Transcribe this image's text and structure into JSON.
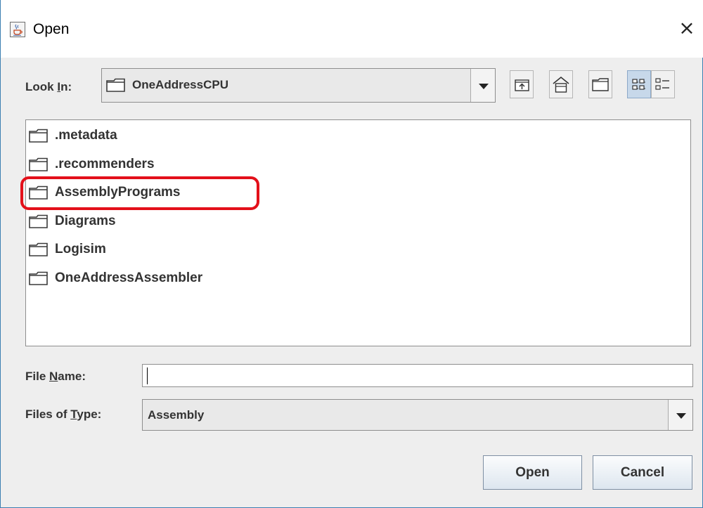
{
  "window": {
    "title": "Open",
    "close_glyph": "×",
    "icon": "java-cup-icon"
  },
  "look_in": {
    "label": "Look In:",
    "mnemonic": "L",
    "selected": "OneAddressCPU"
  },
  "toolbar": {
    "buttons": [
      "up-one-level-icon",
      "home-icon",
      "new-folder-icon",
      "list-view-icon",
      "details-view-icon"
    ],
    "active": "list-view-icon"
  },
  "files": [
    {
      "name": ".metadata",
      "highlighted": false
    },
    {
      "name": ".recommenders",
      "highlighted": false
    },
    {
      "name": "AssemblyPrograms",
      "highlighted": true
    },
    {
      "name": "Diagrams",
      "highlighted": false
    },
    {
      "name": "Logisim",
      "highlighted": false
    },
    {
      "name": "OneAddressAssembler",
      "highlighted": false
    }
  ],
  "file_name": {
    "label": "File Name:",
    "value": "",
    "mnemonic": "N"
  },
  "file_type": {
    "label": "Files of Type:",
    "value": "Assembly",
    "mnemonic": "T"
  },
  "buttons": {
    "open": "Open",
    "cancel": "Cancel"
  },
  "colors": {
    "highlight_annotation": "#e3101a",
    "title_border": "#3c7fb1",
    "text": "#333333"
  }
}
